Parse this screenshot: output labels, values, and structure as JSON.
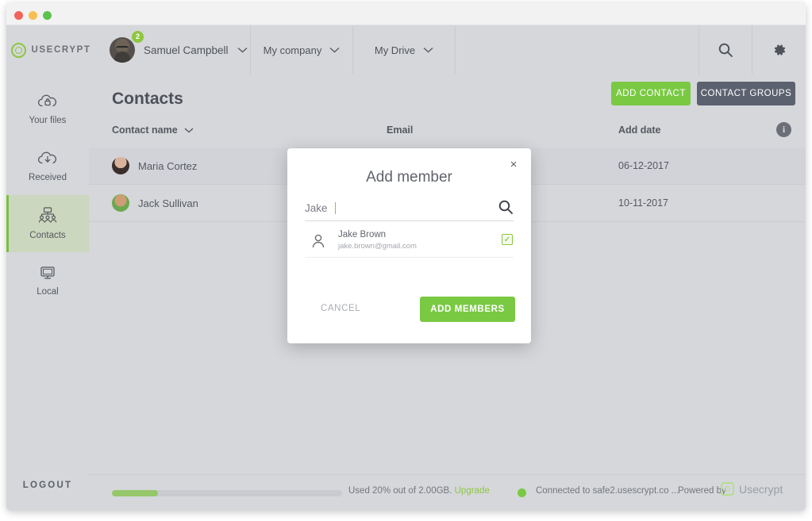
{
  "window": {
    "traffic_lights": [
      "close",
      "minimize",
      "maximize"
    ]
  },
  "header": {
    "brand": "USECRYPT",
    "user_name": "Samuel Campbell",
    "notification_count": "2",
    "company_tab": "My company",
    "drive_tab": "My Drive",
    "search_icon": "search-icon",
    "settings_icon": "gear-icon"
  },
  "sidebar": {
    "items": [
      {
        "label": "Your files",
        "icon": "cloud-lock-icon",
        "active": false
      },
      {
        "label": "Received",
        "icon": "cloud-download-icon",
        "active": false
      },
      {
        "label": "Contacts",
        "icon": "people-group-icon",
        "active": true
      },
      {
        "label": "Local",
        "icon": "monitor-icon",
        "active": false
      }
    ],
    "logout": "LOGOUT"
  },
  "main": {
    "title": "Contacts",
    "add_contact_label": "ADD CONTACT",
    "contact_groups_label": "CONTACT GROUPS",
    "columns": {
      "name": "Contact name",
      "email": "Email",
      "date": "Add date"
    },
    "rows": [
      {
        "name": "Maria Cortez",
        "email": "",
        "date": "06-12-2017"
      },
      {
        "name": "Jack Sullivan",
        "email": "",
        "date": "10-11-2017"
      }
    ]
  },
  "footer": {
    "used_text": "Used 20% out of 2.00GB.",
    "upgrade_label": "Upgrade",
    "progress_percent": 20,
    "connection_text": "Connected to safe2.usescrypt.co ...",
    "powered_by": "Powered by",
    "powered_brand": "Usecrypt"
  },
  "modal": {
    "title": "Add member",
    "close_label": "×",
    "search_value": "Jake",
    "search_icon": "search-icon",
    "results": [
      {
        "name": "Jake Brown",
        "email": "jake.brown@gmail.com",
        "checked": true,
        "check_glyph": "✓"
      }
    ],
    "cancel_label": "CANCEL",
    "submit_label": "ADD MEMBERS"
  },
  "colors": {
    "accent_green": "#7ac943",
    "brand_green": "#8dc63f",
    "header_bg": "#d5d7db",
    "dark_button": "#5c6170",
    "active_sidebar": "#cbd7be"
  }
}
